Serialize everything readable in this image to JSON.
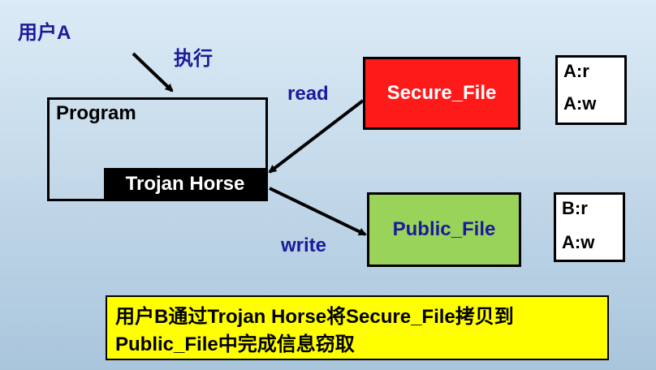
{
  "labels": {
    "user_a": "用户A",
    "execute": "执行",
    "program": "Program",
    "trojan": "Trojan Horse",
    "read": "read",
    "write": "write"
  },
  "files": {
    "secure": {
      "name": "Secure_File",
      "acl": [
        "A:r",
        "A:w"
      ]
    },
    "public": {
      "name": "Public_File",
      "acl": [
        "B:r",
        "A:w"
      ]
    }
  },
  "caption": {
    "line1": "用户B通过Trojan Horse将Secure_File拷贝到",
    "line2": "Public_File中完成信息窃取"
  },
  "colors": {
    "secure_fill": "#ff1a1a",
    "public_fill": "#99d35a",
    "caption_fill": "#ffff00",
    "label_blue": "#1a1a9c"
  }
}
